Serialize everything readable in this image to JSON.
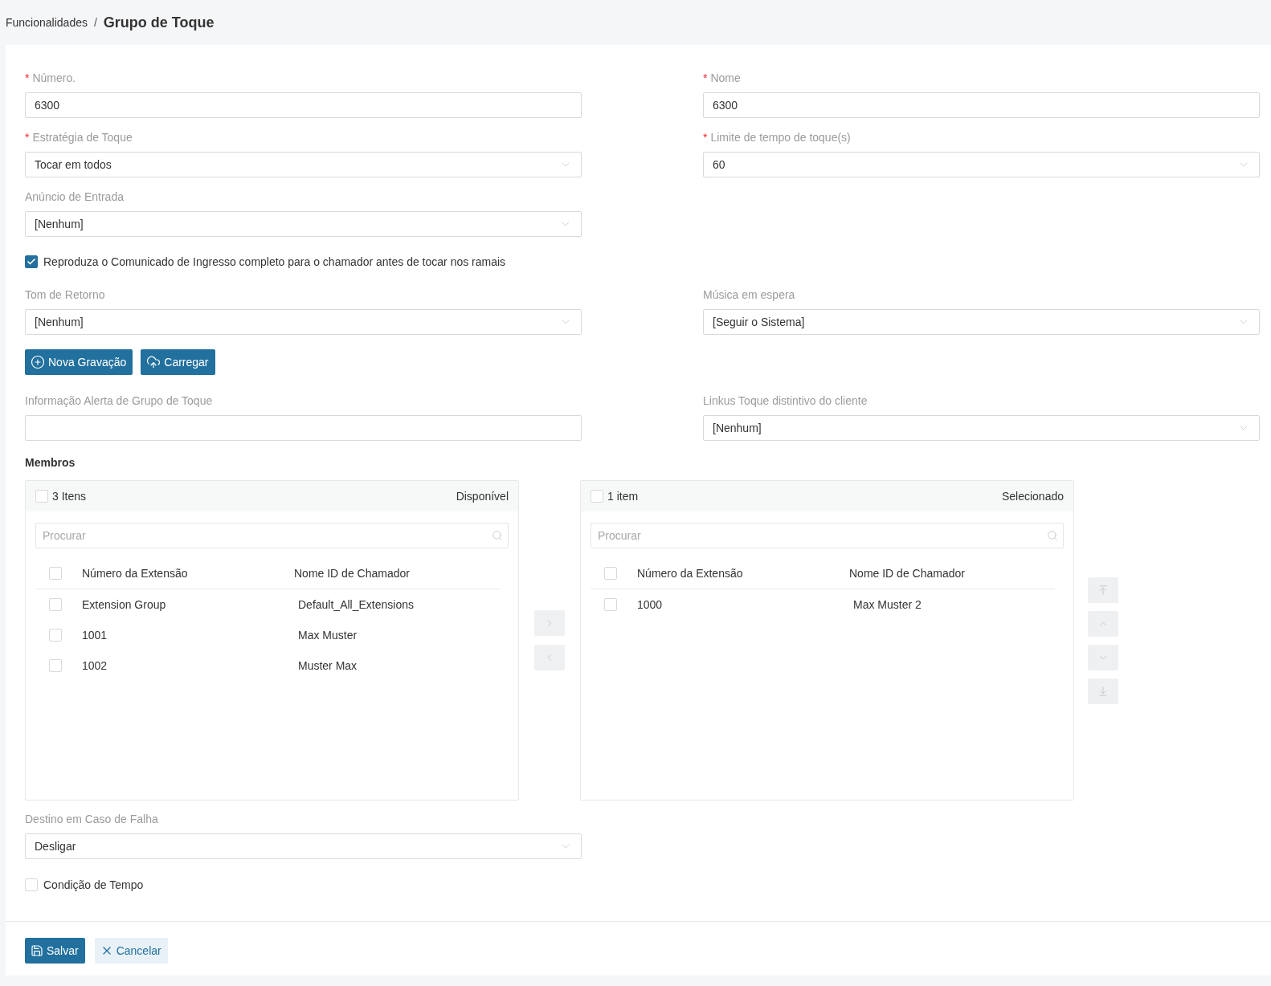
{
  "breadcrumb": {
    "parent": "Funcionalidades",
    "separator": "/",
    "current": "Grupo de Toque"
  },
  "form_top": {
    "rows": [
      {
        "cells": [
          {
            "kind": "input",
            "marker": "*",
            "label": "Número.",
            "value": "6300"
          },
          {
            "kind": "input",
            "marker": "*",
            "label": "Nome",
            "value": "6300"
          }
        ]
      },
      {
        "cells": [
          {
            "kind": "select",
            "marker": "*",
            "label": "Estratégia de Toque",
            "value": "Tocar em todos"
          },
          {
            "kind": "select",
            "marker": "*",
            "label": "Limite de tempo de toque(s)",
            "value": "60"
          }
        ]
      },
      {
        "cells": [
          {
            "kind": "select",
            "label": "Anúncio de Entrada",
            "value": "[Nenhum]"
          }
        ]
      },
      {
        "cells": [
          {
            "kind": "checkbox",
            "label": "Reproduza o Comunicado de Ingresso completo para o chamador antes de tocar nos ramais",
            "checked": true
          }
        ]
      },
      {
        "cells": [
          {
            "kind": "select",
            "label": "Tom de Retorno",
            "value": "[Nenhum]"
          },
          {
            "kind": "select",
            "label": "Música em espera",
            "value": "[Seguir o Sistema]"
          }
        ]
      },
      {
        "cells": [
          {
            "kind": "buttons",
            "buttons": [
              "Nova Gravação",
              "Carregar"
            ]
          }
        ]
      },
      {
        "cells": [
          {
            "kind": "input",
            "label": "Informação Alerta de Grupo de Toque"
          },
          {
            "kind": "select",
            "label": "Linkus Toque distintivo do cliente",
            "value": "[Nenhum]"
          }
        ]
      }
    ]
  },
  "members": {
    "title": "Membros",
    "available_list": {
      "checked": false,
      "count": "3 Itens",
      "title": "Disponível",
      "search_placeholder": "Procurar",
      "columns": [
        "Número da Extensão",
        "Nome ID de Chamador"
      ],
      "all_checked": false,
      "rows": [
        {
          "checked": false,
          "number": "Extension Group",
          "caller_id": "Default_All_Extensions"
        },
        {
          "checked": false,
          "number": "1001",
          "caller_id": "Max Muster"
        },
        {
          "checked": false,
          "number": "1002",
          "caller_id": "Muster Max"
        }
      ]
    },
    "move_buttons": [
      {
        "disabled": true
      },
      {
        "disabled": true
      }
    ],
    "selected_list": {
      "checked": false,
      "count": "1 item",
      "title": "Selecionado",
      "search_placeholder": "Procurar",
      "columns": [
        "Número da Extensão",
        "Nome ID de Chamador"
      ],
      "all_checked": false,
      "rows": [
        {
          "checked": false,
          "number": "1000",
          "caller_id": "Max Muster 2"
        }
      ]
    },
    "order_buttons": [
      {
        "disabled": true
      },
      {
        "disabled": true
      },
      {
        "disabled": true
      },
      {
        "disabled": true
      }
    ]
  },
  "form_bottom": {
    "rows": [
      {
        "cells": [
          {
            "kind": "select",
            "label": "Destino em Caso de Falha",
            "value": "Desligar"
          }
        ]
      },
      {
        "cells": [
          {
            "kind": "checkbox",
            "label": "Condição de Tempo",
            "checked": false
          }
        ]
      }
    ]
  },
  "footer": {
    "buttons": [
      {
        "kind": "primary",
        "label": "Salvar"
      },
      {
        "kind": "secondary",
        "label": "Cancelar"
      }
    ]
  }
}
